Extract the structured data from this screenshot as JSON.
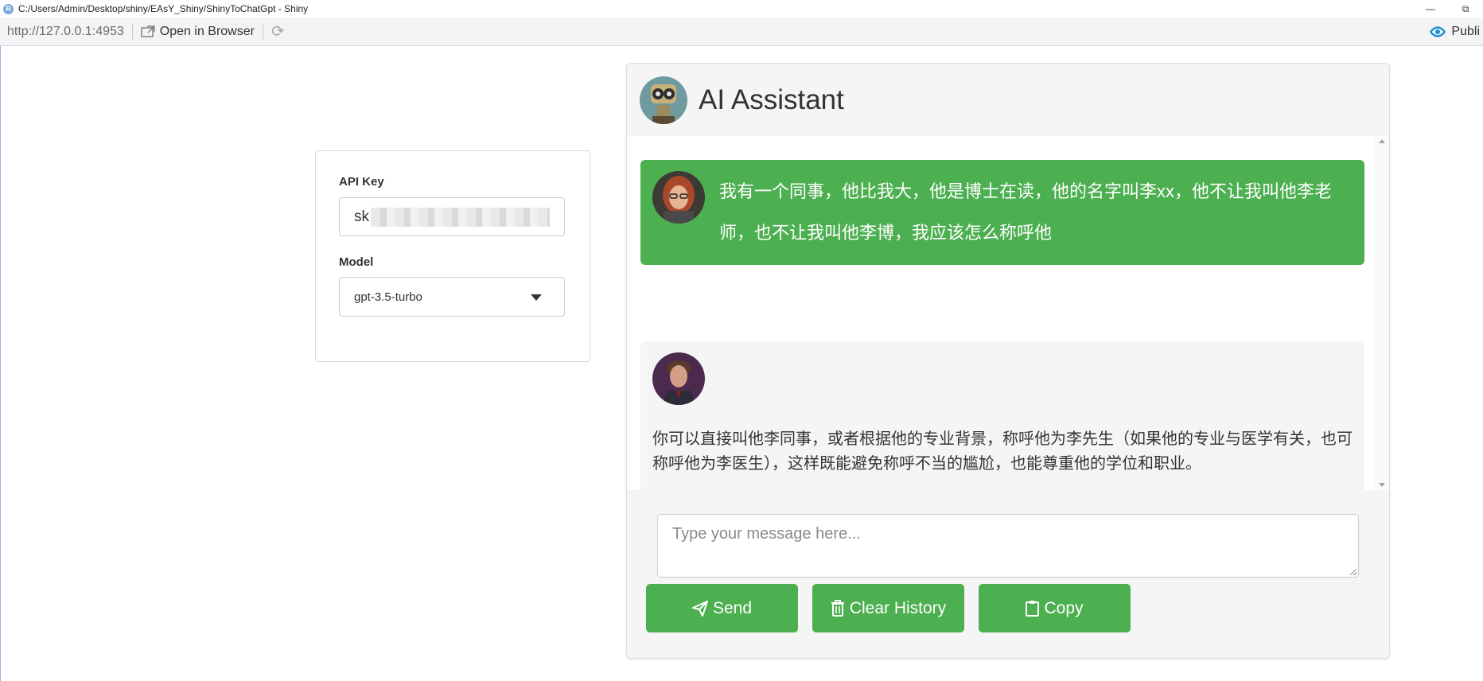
{
  "window": {
    "app_logo": "R",
    "title": "C:/Users/Admin/Desktop/shiny/EAsY_Shiny/ShinyToChatGpt - Shiny",
    "controls": [
      "minimize-icon",
      "restore-icon"
    ]
  },
  "toolbar": {
    "url": "http://127.0.0.1:4953",
    "open_browser_label": "Open in Browser",
    "refresh_icon": "refresh-icon",
    "publish_label": "Publi"
  },
  "sidebar": {
    "api_key": {
      "label": "API Key",
      "value_visible": "sk",
      "value_masked": true
    },
    "model": {
      "label": "Model",
      "selected": "gpt-3.5-turbo"
    }
  },
  "chat": {
    "title": "AI Assistant",
    "messages": [
      {
        "role": "user",
        "avatar": "user-avatar",
        "text": "我有一个同事，他比我大，他是博士在读，他的名字叫李xx，他不让我叫他李老师，也不让我叫他李博，我应该怎么称呼他"
      },
      {
        "role": "assistant",
        "avatar": "assistant-avatar",
        "text": "你可以直接叫他李同事，或者根据他的专业背景，称呼他为李先生（如果他的专业与医学有关，也可称呼他为李医生），这样既能避免称呼不当的尴尬，也能尊重他的学位和职业。"
      }
    ],
    "input_placeholder": "Type your message here...",
    "buttons": {
      "send": "Send",
      "clear": "Clear History",
      "copy": "Copy"
    }
  },
  "colors": {
    "accent_green": "#4caf50",
    "panel_bg": "#f5f5f5",
    "text_dark": "#333333"
  }
}
